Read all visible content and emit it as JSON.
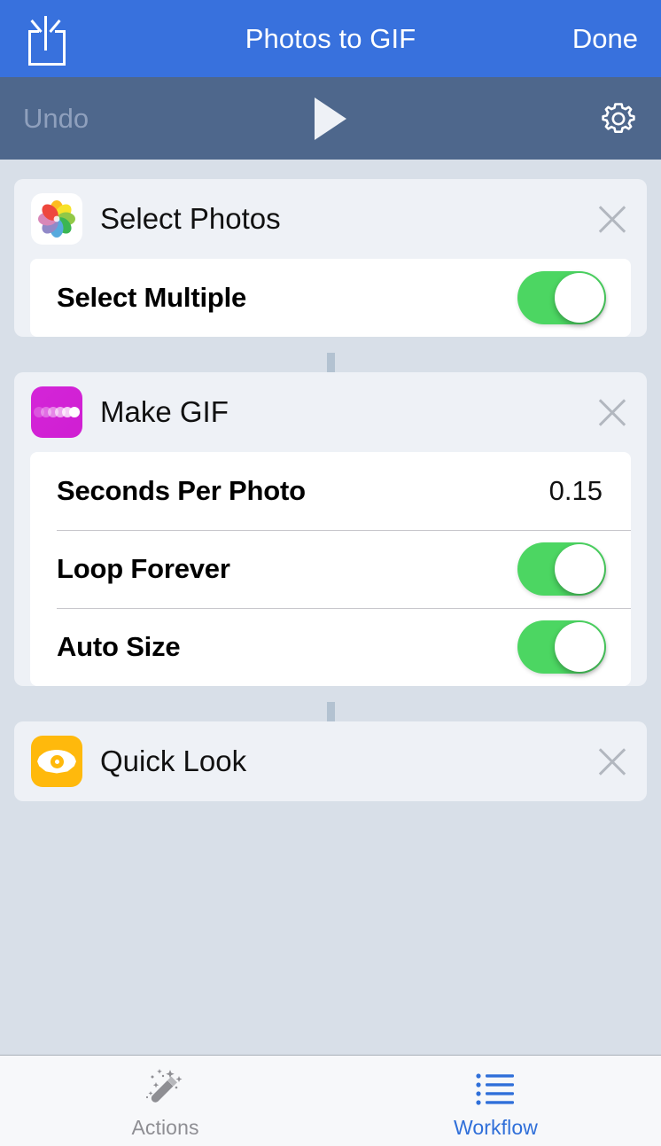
{
  "navbar": {
    "share_icon": "share-icon",
    "title": "Photos to GIF",
    "done_label": "Done"
  },
  "toolbar": {
    "undo_label": "Undo",
    "play_icon": "play-icon",
    "settings_icon": "gear-icon"
  },
  "workflow": {
    "cards": [
      {
        "id": "select-photos",
        "icon": "photos-app-icon",
        "title": "Select Photos",
        "close_icon": "close-icon",
        "rows": [
          {
            "label": "Select Multiple",
            "type": "toggle",
            "value": "on"
          }
        ]
      },
      {
        "id": "make-gif",
        "icon": "make-gif-icon",
        "title": "Make GIF",
        "close_icon": "close-icon",
        "rows": [
          {
            "label": "Seconds Per Photo",
            "type": "value",
            "value": "0.15"
          },
          {
            "label": "Loop Forever",
            "type": "toggle",
            "value": "on"
          },
          {
            "label": "Auto Size",
            "type": "toggle",
            "value": "on"
          }
        ]
      },
      {
        "id": "quick-look",
        "icon": "quick-look-icon",
        "title": "Quick Look",
        "close_icon": "close-icon",
        "rows": []
      }
    ]
  },
  "tabbar": {
    "tabs": [
      {
        "id": "actions",
        "label": "Actions",
        "icon": "magic-wand-icon",
        "active": false
      },
      {
        "id": "workflow",
        "label": "Workflow",
        "icon": "list-icon",
        "active": true
      }
    ]
  },
  "colors": {
    "navbar_blue": "#3871dd",
    "toolbar_slate": "#4e678c",
    "page_background": "#d8dfe8",
    "card_background": "#eef1f6",
    "panel_white": "#ffffff",
    "toggle_green": "#4cd662",
    "gif_magenta": "#d724d7",
    "quicklook_amber": "#ffb90c",
    "active_tab_blue": "#2f6fd9",
    "inactive_tab_gray": "#8e8e93",
    "connector_gray": "#b3c2d1"
  }
}
